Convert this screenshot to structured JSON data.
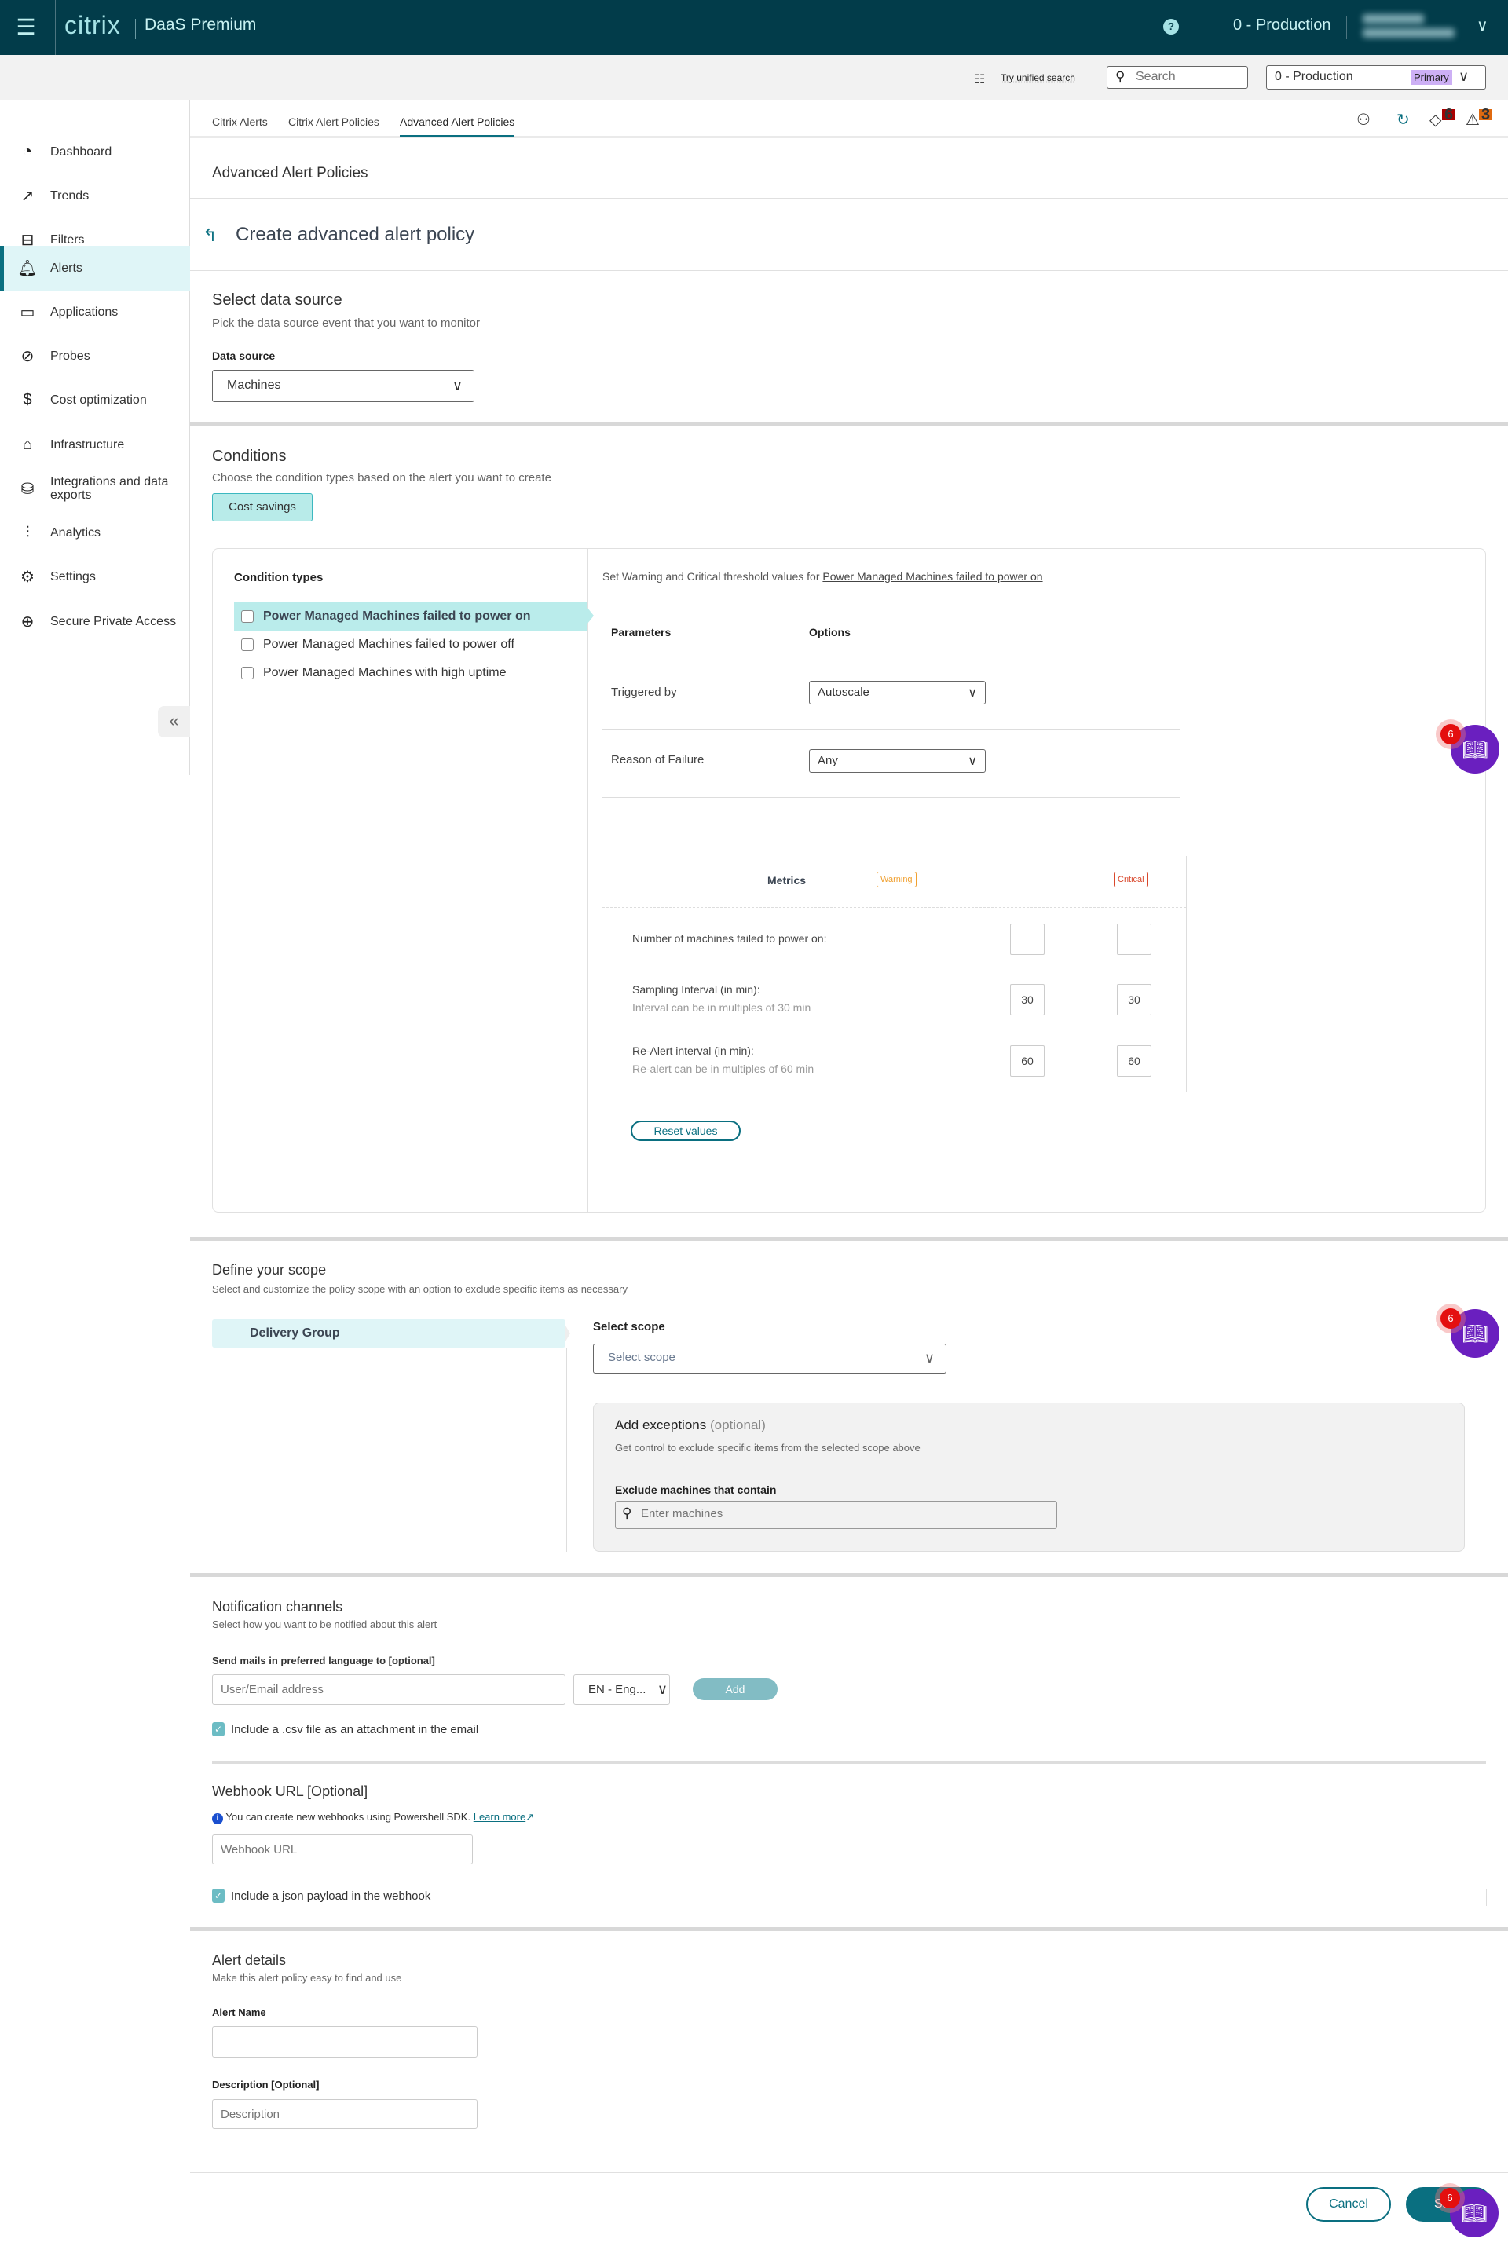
{
  "header": {
    "brand": "citrix",
    "product": "DaaS Premium",
    "help_icon": "?",
    "org_name": "0 - Production"
  },
  "subbar": {
    "unified_search_link": "Try unified search",
    "search_placeholder": "Search",
    "org_select_value": "0 - Production",
    "org_select_badge": "Primary"
  },
  "sidebar": {
    "items": [
      {
        "label": "Dashboard",
        "icon": "dashboard-icon",
        "glyph": "◔"
      },
      {
        "label": "Trends",
        "icon": "trends-icon",
        "glyph": "📈"
      },
      {
        "label": "Filters",
        "icon": "filters-icon",
        "glyph": "⚙"
      },
      {
        "label": "Alerts",
        "icon": "bell-icon",
        "glyph": "🔔",
        "active": true
      },
      {
        "label": "Applications",
        "icon": "applications-icon",
        "glyph": "▭"
      },
      {
        "label": "Probes",
        "icon": "probes-icon",
        "glyph": "☑"
      },
      {
        "label": "Cost optimization",
        "icon": "cost-icon",
        "glyph": "$"
      },
      {
        "label": "Infrastructure",
        "icon": "infrastructure-icon",
        "glyph": "🖥"
      },
      {
        "label": "Integrations and data exports",
        "icon": "integrations-icon",
        "glyph": "⛁"
      },
      {
        "label": "Analytics",
        "icon": "analytics-icon",
        "glyph": "📊"
      },
      {
        "label": "Settings",
        "icon": "gear-icon",
        "glyph": "⚙"
      },
      {
        "label": "Secure Private Access",
        "icon": "globe-shield-icon",
        "glyph": "🌐"
      }
    ],
    "collapse_glyph": "«"
  },
  "tabs": [
    {
      "label": "Citrix Alerts"
    },
    {
      "label": "Citrix Alert Policies"
    },
    {
      "label": "Advanced Alert Policies",
      "active": true
    }
  ],
  "toolbar": {
    "alerts_badge": "6",
    "warnings_badge": "3"
  },
  "page": {
    "heading": "Advanced Alert Policies",
    "title": "Create advanced alert policy"
  },
  "data_source": {
    "title": "Select data source",
    "subtitle": "Pick the data source event that you want to monitor",
    "label": "Data source",
    "value": "Machines"
  },
  "conditions": {
    "title": "Conditions",
    "subtitle": "Choose the condition types based on the alert you want to create",
    "category_chip": "Cost savings",
    "types_label": "Condition types",
    "types": [
      {
        "label": "Power Managed Machines failed to power on",
        "selected": true,
        "checked": false
      },
      {
        "label": "Power Managed Machines failed to power off",
        "selected": false,
        "checked": false
      },
      {
        "label": "Power Managed Machines with high uptime",
        "selected": false,
        "checked": false
      }
    ],
    "threshold_intro": "Set Warning and Critical threshold values for ",
    "threshold_link": "Power Managed Machines failed to power on",
    "params_header": "Parameters",
    "options_header": "Options",
    "parameters": [
      {
        "label": "Triggered by",
        "value": "Autoscale"
      },
      {
        "label": "Reason of Failure",
        "value": "Any"
      }
    ],
    "metrics_header": "Metrics",
    "warning_label": "Warning",
    "critical_label": "Critical",
    "warning_color": "#f0a030",
    "critical_color": "#d9472b",
    "metrics": [
      {
        "label": "Number of machines failed to power on:",
        "hint": "",
        "warning": "",
        "critical": ""
      },
      {
        "label": "Sampling Interval (in min):",
        "hint": "Interval can be in multiples of 30 min",
        "warning": "30",
        "critical": "30"
      },
      {
        "label": "Re-Alert interval (in min):",
        "hint": "Re-alert can be in multiples of 60 min",
        "warning": "60",
        "critical": "60"
      }
    ],
    "reset_label": "Reset values"
  },
  "scope": {
    "title": "Define your scope",
    "subtitle": "Select and customize the policy scope with an option to exclude specific items as necessary",
    "item": "Delivery Group",
    "select_label": "Select scope",
    "select_placeholder": "Select scope",
    "exceptions_title": "Add exceptions",
    "exceptions_optional": "(optional)",
    "exceptions_subtitle": "Get control to exclude specific items from the selected scope above",
    "exclude_label": "Exclude machines that contain",
    "exclude_placeholder": "Enter machines"
  },
  "notifications": {
    "title": "Notification channels",
    "subtitle": "Select how you want to be notified about this alert",
    "mail_label": "Send mails in preferred language to [optional]",
    "email_placeholder": "User/Email address",
    "language_value": "EN - Eng...",
    "add_label": "Add",
    "csv_label": "Include a .csv file as an attachment in the email",
    "csv_checked": true
  },
  "webhook": {
    "title": "Webhook URL [Optional]",
    "info": "You can create new webhooks using Powershell SDK.",
    "learn_more": "Learn more",
    "placeholder": "Webhook URL",
    "json_label": "Include a json payload in the webhook",
    "json_checked": true
  },
  "details": {
    "title": "Alert details",
    "subtitle": "Make this alert policy easy to find and use",
    "name_label": "Alert Name",
    "name_value": "",
    "desc_label": "Description [Optional]",
    "desc_placeholder": "Description"
  },
  "footer": {
    "cancel_label": "Cancel",
    "save_label": "Save"
  },
  "help_fab": {
    "badge": "6"
  }
}
